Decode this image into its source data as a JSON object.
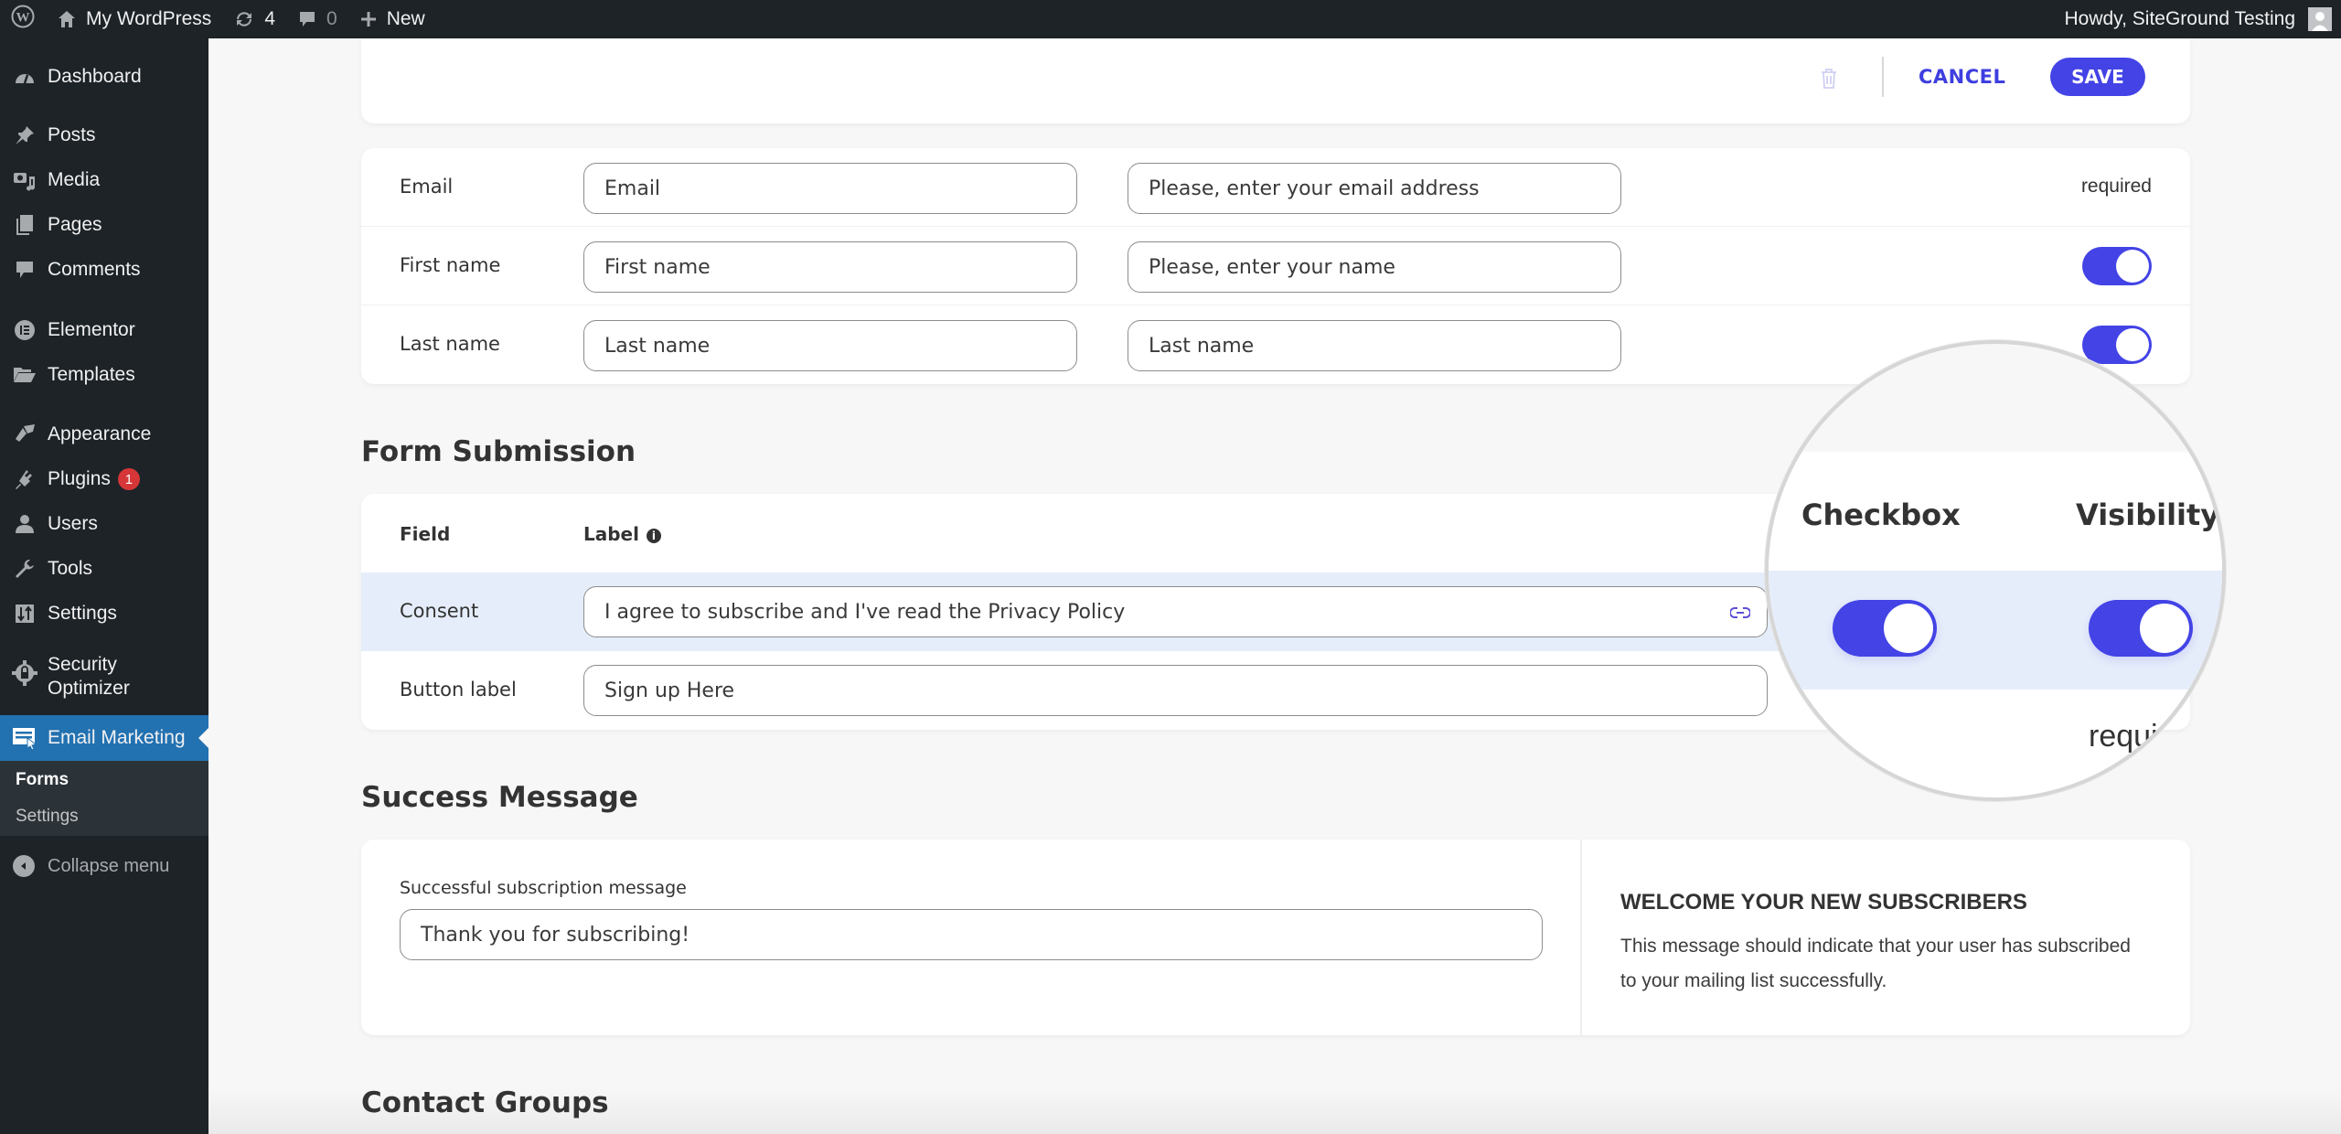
{
  "admin_bar": {
    "site_name": "My WordPress",
    "updates_count": "4",
    "comments_count": "0",
    "new_label": "New",
    "greeting": "Howdy, SiteGround Testing"
  },
  "sidebar": {
    "items": [
      {
        "label": "Dashboard",
        "icon": "dashboard-icon"
      },
      {
        "label": "Posts",
        "icon": "pin-icon"
      },
      {
        "label": "Media",
        "icon": "media-icon"
      },
      {
        "label": "Pages",
        "icon": "pages-icon"
      },
      {
        "label": "Comments",
        "icon": "comment-icon"
      },
      {
        "label": "Elementor",
        "icon": "elementor-icon"
      },
      {
        "label": "Templates",
        "icon": "folder-icon"
      },
      {
        "label": "Appearance",
        "icon": "brush-icon"
      },
      {
        "label": "Plugins",
        "icon": "plugin-icon",
        "badge": "1"
      },
      {
        "label": "Users",
        "icon": "user-icon"
      },
      {
        "label": "Tools",
        "icon": "wrench-icon"
      },
      {
        "label": "Settings",
        "icon": "settings-icon"
      },
      {
        "label": "Security Optimizer",
        "label_line1": "Security",
        "label_line2": "Optimizer",
        "icon": "security-gear-icon"
      },
      {
        "label": "Email Marketing",
        "icon": "email-marketing-icon",
        "active": true
      }
    ],
    "submenu": [
      {
        "label": "Forms",
        "current": true
      },
      {
        "label": "Settings",
        "current": false
      }
    ],
    "collapse_label": "Collapse menu"
  },
  "toolbar": {
    "cancel_label": "CANCEL",
    "save_label": "SAVE"
  },
  "fields": [
    {
      "field": "Email",
      "label_value": "Email",
      "placeholder_value": "Please, enter your email address",
      "status": "required",
      "visible": null
    },
    {
      "field": "First name",
      "label_value": "First name",
      "placeholder_value": "Please, enter your name",
      "status": null,
      "visible": true
    },
    {
      "field": "Last name",
      "label_value": "Last name",
      "placeholder_value": "Last name",
      "status": null,
      "visible": true
    }
  ],
  "form_submission": {
    "title": "Form Submission",
    "headers": {
      "field": "Field",
      "label": "Label"
    },
    "rows": [
      {
        "field": "Consent",
        "value": "I agree to subscribe and I've read the Privacy Policy",
        "checkbox": true,
        "visible": true
      },
      {
        "field": "Button label",
        "value": "Sign up Here"
      }
    ]
  },
  "magnifier": {
    "checkbox_header": "Checkbox",
    "visibility_header": "Visibility",
    "checkbox_on": true,
    "visibility_on": true,
    "partial_text": "require"
  },
  "success_message": {
    "title": "Success Message",
    "field_label": "Successful subscription message",
    "value": "Thank you for subscribing!",
    "help_title": "WELCOME YOUR NEW SUBSCRIBERS",
    "help_text": "This message should indicate that your user has subscribed to your mailing list successfully."
  },
  "contact_groups": {
    "title": "Contact Groups"
  },
  "colors": {
    "accent": "#4343e6",
    "admin_bar": "#1d2327",
    "active_menu": "#2271b1",
    "highlight_row": "#e6edfa",
    "badge": "#d63638"
  }
}
